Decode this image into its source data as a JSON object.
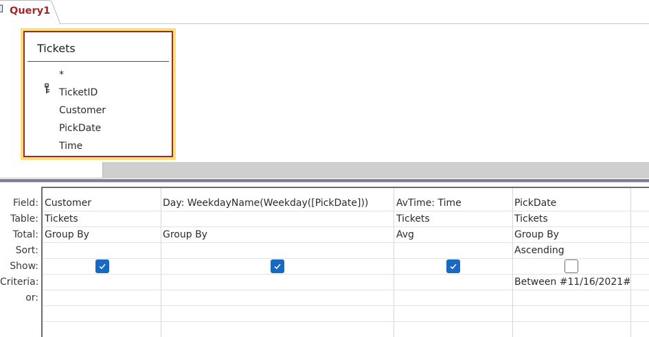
{
  "tab": {
    "label": "Query1"
  },
  "table_box": {
    "title": "Tickets",
    "fields": [
      "*",
      "TicketID",
      "Customer",
      "PickDate",
      "Time"
    ]
  },
  "grid": {
    "row_labels": {
      "field": "Field:",
      "table": "Table:",
      "total": "Total:",
      "sort": "Sort:",
      "show": "Show:",
      "criteria": "Criteria:",
      "or": "or:"
    },
    "columns": [
      {
        "field": "Customer",
        "table": "Tickets",
        "total": "Group By",
        "sort": "",
        "show": true,
        "criteria": ""
      },
      {
        "field": "Day: WeekdayName(Weekday([PickDate]))",
        "table": "",
        "total": "Group By",
        "sort": "",
        "show": true,
        "criteria": ""
      },
      {
        "field": "AvTime: Time",
        "table": "Tickets",
        "total": "Avg",
        "sort": "",
        "show": true,
        "criteria": ""
      },
      {
        "field": "PickDate",
        "table": "Tickets",
        "total": "Group By",
        "sort": "Ascending",
        "show": false,
        "criteria": "Between #11/16/2021#"
      }
    ]
  },
  "colors": {
    "tab_text": "#a4262c",
    "table_border": "#9e2a2b",
    "table_highlight": "#ffde7a",
    "checkbox_on": "#1769c4"
  }
}
